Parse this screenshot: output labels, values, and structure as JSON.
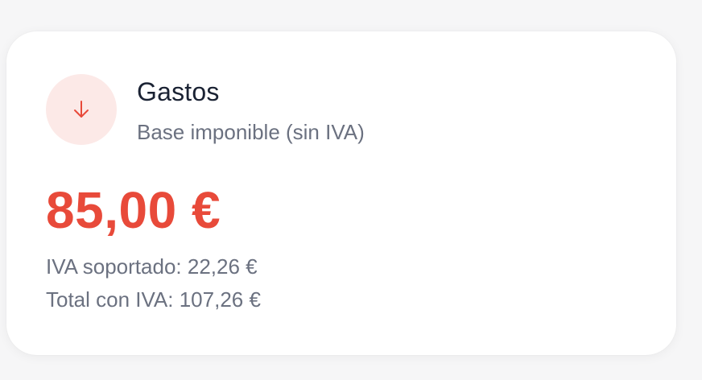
{
  "card": {
    "title": "Gastos",
    "subtitle": "Base imponible (sin IVA)",
    "icon": "arrow-down-icon",
    "amount": "85,00 €",
    "vat_line": "IVA soportado: 22,26 €",
    "total_line": "Total con IVA: 107,26 €"
  },
  "colors": {
    "accent": "#e84a3a",
    "icon_bg": "#fce9e7",
    "title": "#1a2233",
    "muted": "#6b7180"
  }
}
